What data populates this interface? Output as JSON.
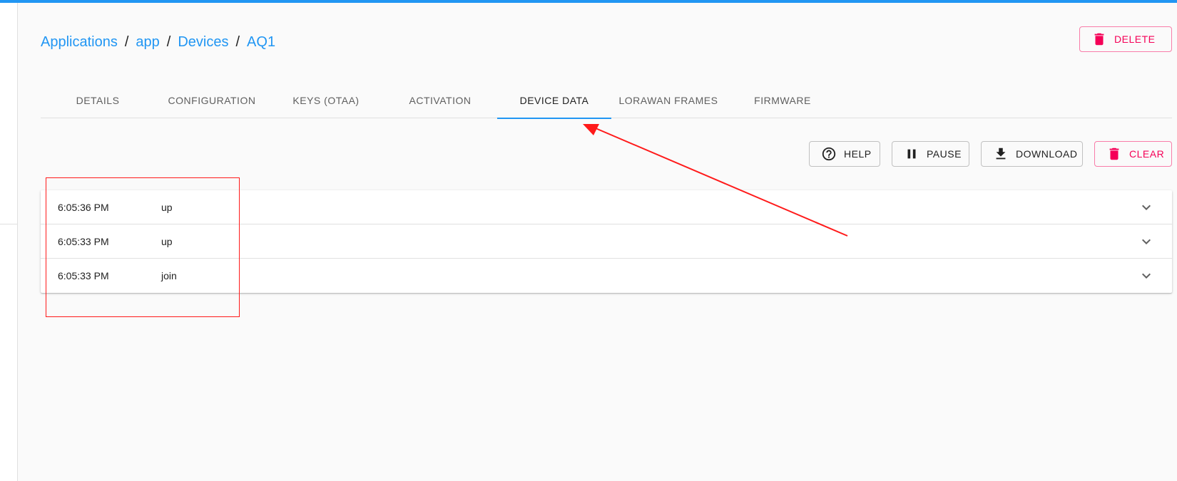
{
  "breadcrumb": {
    "items": [
      "Applications",
      "app",
      "Devices",
      "AQ1"
    ],
    "separator": "/"
  },
  "header": {
    "delete_label": "DELETE"
  },
  "tabs": [
    {
      "label": "DETAILS",
      "active": false
    },
    {
      "label": "CONFIGURATION",
      "active": false
    },
    {
      "label": "KEYS (OTAA)",
      "active": false
    },
    {
      "label": "ACTIVATION",
      "active": false
    },
    {
      "label": "DEVICE DATA",
      "active": true
    },
    {
      "label": "LORAWAN FRAMES",
      "active": false
    },
    {
      "label": "FIRMWARE",
      "active": false
    }
  ],
  "toolbar": {
    "help_label": "HELP",
    "pause_label": "PAUSE",
    "download_label": "DOWNLOAD",
    "clear_label": "CLEAR"
  },
  "events": [
    {
      "time": "6:05:36 PM",
      "type": "up"
    },
    {
      "time": "6:05:33 PM",
      "type": "up"
    },
    {
      "time": "6:05:33 PM",
      "type": "join"
    }
  ],
  "colors": {
    "accent": "#2196f3",
    "danger": "#f50057",
    "annotation": "#ff1a1a"
  },
  "icons": {
    "delete": "trash-icon",
    "help": "help-circle-icon",
    "pause": "pause-icon",
    "download": "download-icon",
    "clear": "trash-icon",
    "expand": "chevron-down-icon"
  }
}
